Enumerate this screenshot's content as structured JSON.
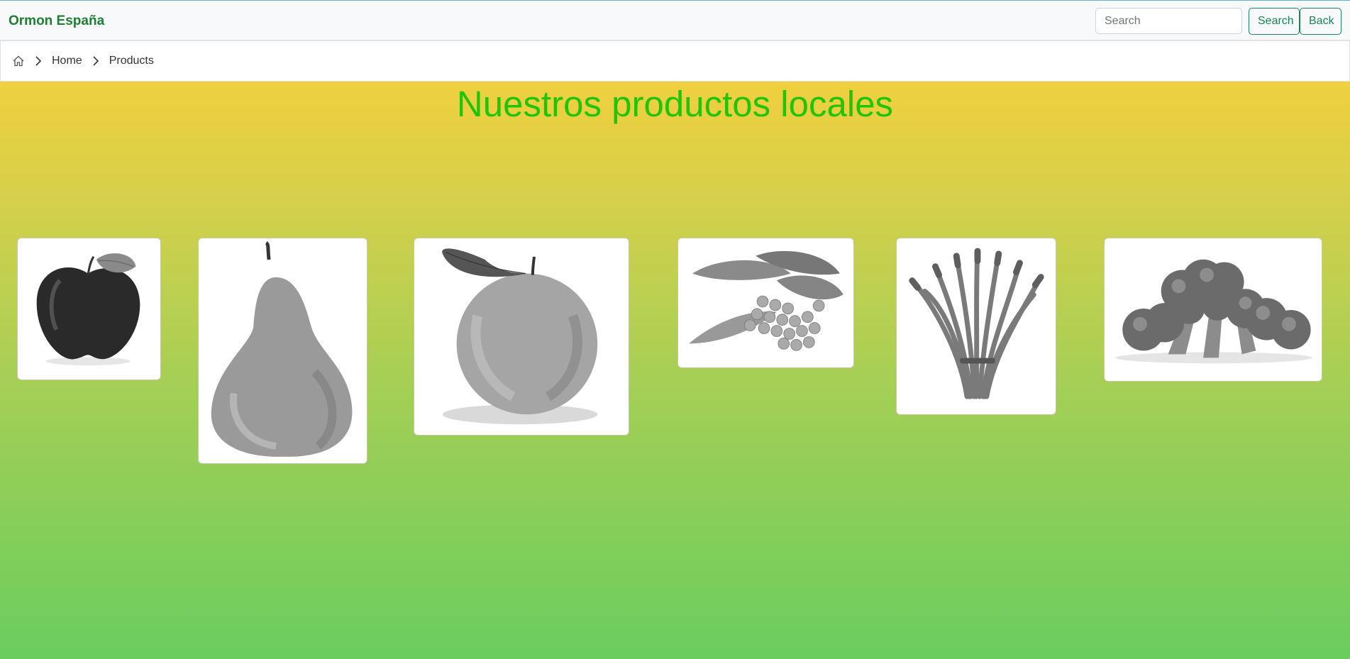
{
  "navbar": {
    "brand": "Ormon España",
    "search_placeholder": "Search",
    "search_button": "Search",
    "back_button": "Back"
  },
  "breadcrumb": {
    "items": [
      "Home",
      "Products"
    ]
  },
  "main": {
    "title": "Nuestros productos locales"
  },
  "products": [
    {
      "name": "apple"
    },
    {
      "name": "pear"
    },
    {
      "name": "orange"
    },
    {
      "name": "peas"
    },
    {
      "name": "asparagus"
    },
    {
      "name": "broccoli"
    }
  ],
  "colors": {
    "brand": "#1e7e34",
    "accent": "#198754",
    "title": "#22c40a",
    "gradient_top": "#f0d03e",
    "gradient_bottom": "#6acd5e"
  }
}
